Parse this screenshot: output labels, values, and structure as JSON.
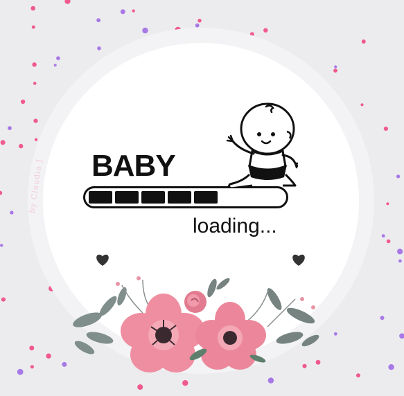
{
  "scene": {
    "title_text": "BABY",
    "status_text": "loading...",
    "watermark_text": "by Claudia J",
    "progress": {
      "filled_segments": 5,
      "total_segments": 8,
      "fraction": 0.62
    },
    "icons": [
      "baby-icon",
      "heart-icon",
      "flower-icon"
    ],
    "colors": {
      "background": "#ececef",
      "circle": "#ffffff",
      "ring": "#f3f3f5",
      "ink": "#111111",
      "dot_pink": "#f05a8c",
      "dot_purple": "#a879e6",
      "flower_pink": "#ef8ea0",
      "leaf_gray": "#7a8a86",
      "watermark": "#f2c9d3"
    }
  }
}
